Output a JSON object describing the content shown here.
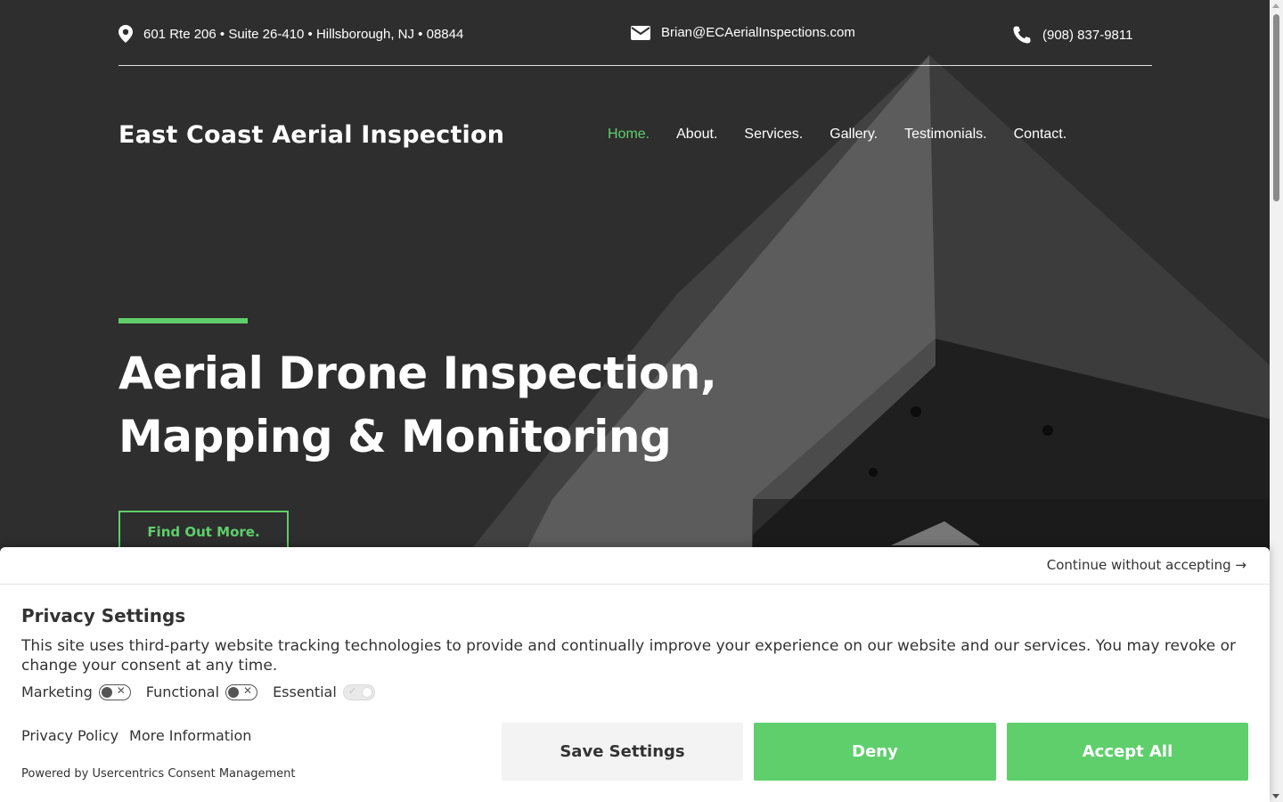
{
  "topbar": {
    "address": "601 Rte 206 • Suite 26-410 • Hillsborough, NJ • 08844",
    "email": "Brian@ECAerialInspections.com",
    "phone": "(908) 837-9811"
  },
  "brand": "East Coast Aerial Inspection",
  "nav": {
    "home": "Home.",
    "about": "About.",
    "services": "Services.",
    "gallery": "Gallery.",
    "testimonials": "Testimonials.",
    "contact": "Contact."
  },
  "hero": {
    "headline_line1": "Aerial Drone Inspection,",
    "headline_line2": "Mapping & Monitoring",
    "cta": "Find Out More."
  },
  "consent": {
    "continue": "Continue without accepting →",
    "title": "Privacy Settings",
    "description": "This site uses third-party website tracking technologies to provide and continually improve your experience on our website and our services. You may revoke or change your consent at any time.",
    "toggles": {
      "marketing": "Marketing",
      "functional": "Functional",
      "essential": "Essential"
    },
    "privacy_policy": "Privacy Policy",
    "more_information": "More Information",
    "powered_by": "Powered by Usercentrics Consent Management",
    "save_settings": "Save Settings",
    "deny": "Deny",
    "accept_all": "Accept All"
  },
  "colors": {
    "accent": "#5fcf6c",
    "hero_bg": "#2e2e2e",
    "button_light": "#f3f3f3"
  }
}
